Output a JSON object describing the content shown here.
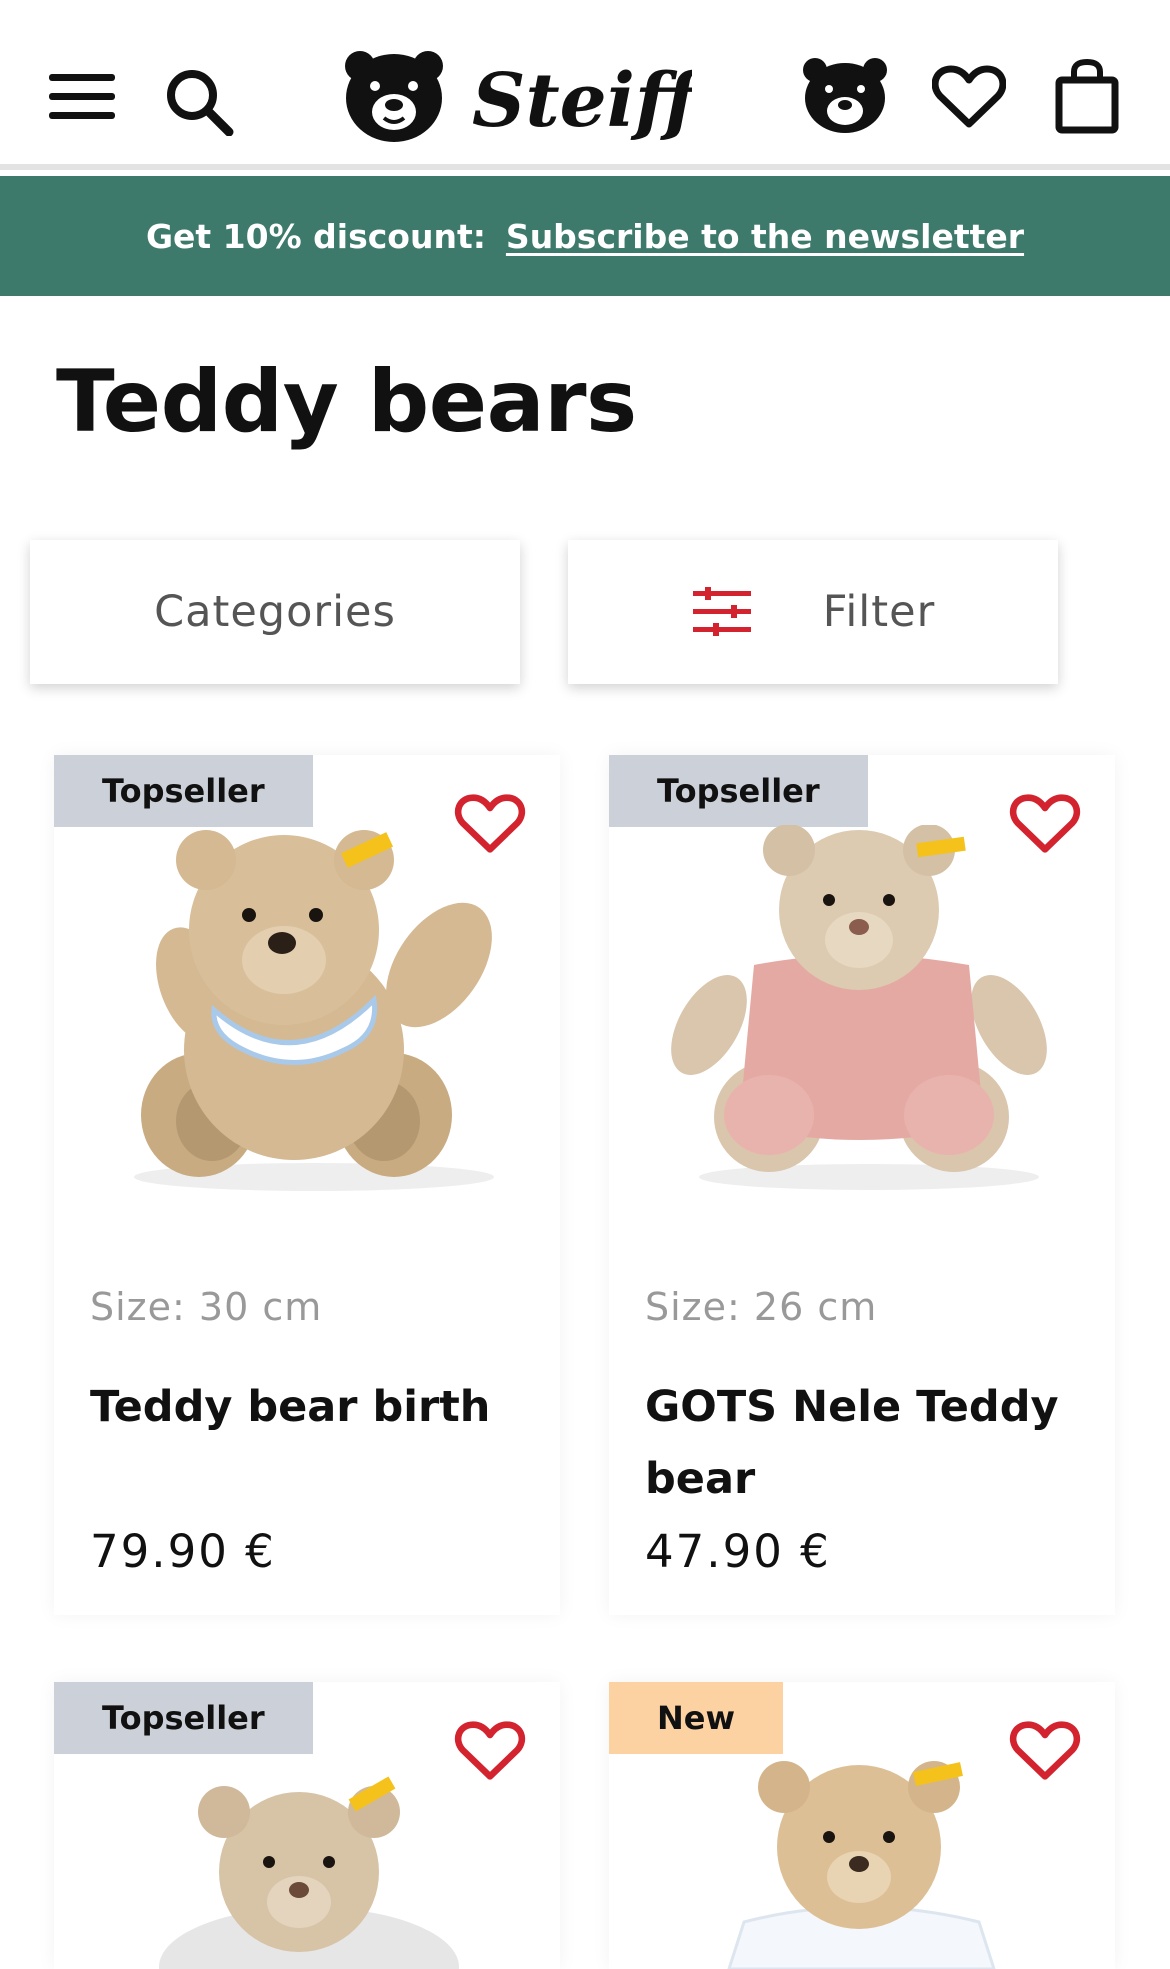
{
  "header": {
    "logo_text": "Steiff",
    "icons": [
      "menu-icon",
      "search-icon",
      "bear-account-icon",
      "heart-icon",
      "shopping-bag-icon"
    ]
  },
  "promo": {
    "label": "Get 10% discount:",
    "link": "Subscribe to the newsletter"
  },
  "page": {
    "title": "Teddy bears"
  },
  "controls": {
    "categories_label": "Categories",
    "filter_label": "Filter"
  },
  "products": [
    {
      "badge": "Topseller",
      "size": "Size: 30 cm",
      "name": "Teddy bear birth",
      "price": "79.90 €"
    },
    {
      "badge": "Topseller",
      "size": "Size: 26 cm",
      "name": "GOTS Nele Teddy bear",
      "price": "47.90 €"
    },
    {
      "badge": "Topseller"
    },
    {
      "badge": "New"
    }
  ],
  "colors": {
    "promo_bg": "#3d7a6b",
    "accent_red": "#d3232f",
    "badge_topseller": "#ccd0d8",
    "badge_new": "#fcd2a3"
  }
}
